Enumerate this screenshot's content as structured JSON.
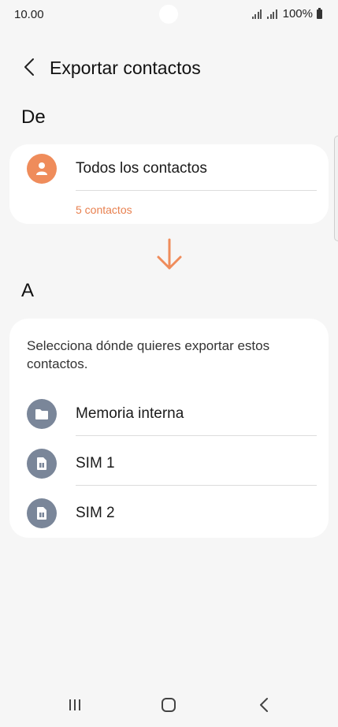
{
  "status_bar": {
    "time": "10.00",
    "battery": "100%"
  },
  "header": {
    "title": "Exportar contactos",
    "back_icon": "chevron-left-icon"
  },
  "from_section": {
    "label": "De",
    "source": {
      "label": "Todos los contactos",
      "count": "5 contactos",
      "icon": "person-icon",
      "icon_color": "#ef8c5b"
    }
  },
  "arrow": {
    "icon": "arrow-down-icon",
    "color": "#ef8c5b"
  },
  "to_section": {
    "label": "A",
    "instruction": "Selecciona dónde quieres exportar estos contactos.",
    "destinations": [
      {
        "label": "Memoria interna",
        "icon": "folder-icon"
      },
      {
        "label": "SIM 1",
        "icon": "sim-card-icon"
      },
      {
        "label": "SIM 2",
        "icon": "sim-card-icon"
      }
    ],
    "icon_color": "#7a8699"
  },
  "nav_bar": {
    "recents_icon": "recents-icon",
    "home_icon": "home-icon",
    "back_icon": "back-icon"
  },
  "accent_color": "#e8804f"
}
